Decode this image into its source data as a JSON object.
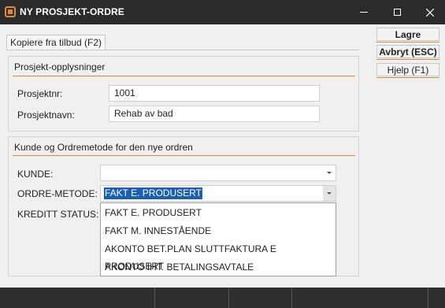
{
  "window": {
    "title": "NY PROSJEKT-ORDRE",
    "accent_color": "#e08a3c",
    "icons": [
      "app-logo-icon",
      "minimize-icon",
      "maximize-icon",
      "close-icon"
    ]
  },
  "tab": {
    "label": "Kopiere fra tilbud (F2)"
  },
  "project_section": {
    "title": "Prosjekt-opplysninger",
    "fields": {
      "number_label": "Prosjektnr:",
      "number_value": "1001",
      "name_label": "Prosjektnavn:",
      "name_value": "Rehab av bad"
    }
  },
  "customer_section": {
    "title": "Kunde og Ordremetode for den nye ordren",
    "customer_label": "KUNDE:",
    "customer_value": "",
    "order_method_label": "ORDRE-METODE:",
    "order_method_value": "FAKT E. PRODUSERT",
    "credit_status_label": "KREDITT STATUS:",
    "order_method_options": [
      "FAKT E. PRODUSERT",
      "FAKT M. INNESTÅENDE",
      "AKONTO BET.PLAN SLUTTFAKTURA E PRODUSERT",
      "AKONTO IHT. BETALINGSAVTALE"
    ]
  },
  "actions": {
    "save": "Lagre",
    "cancel": "Avbryt (ESC)",
    "help": "Hjelp (F1)"
  }
}
